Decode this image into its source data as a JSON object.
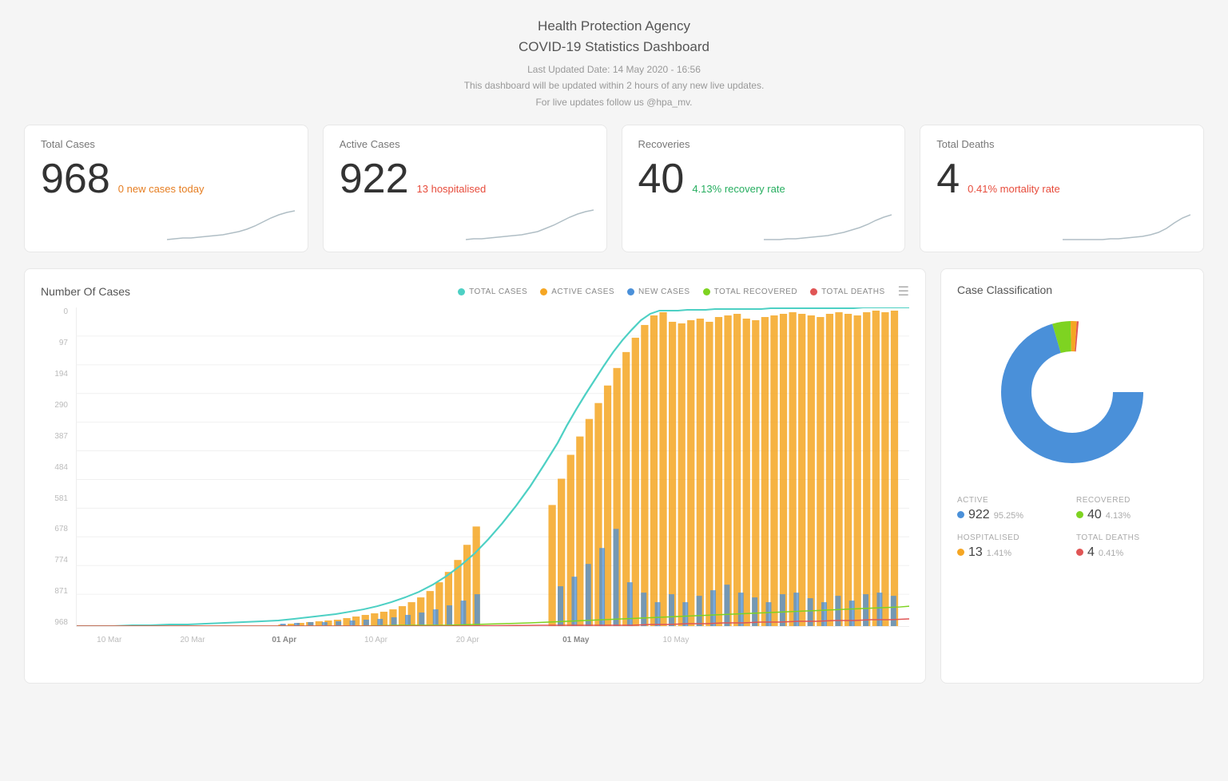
{
  "header": {
    "title_line1": "Health Protection Agency",
    "title_line2": "COVID-19 Statistics Dashboard",
    "updated_label": "Last Updated Date: 14 May 2020 - 16:56",
    "update_note": "This dashboard will be updated within 2 hours of any new live updates.",
    "social": "For live updates follow us @hpa_mv."
  },
  "stat_cards": [
    {
      "label": "Total Cases",
      "number": "968",
      "sub_text": "0 new cases today",
      "sub_color": "orange",
      "id": "total-cases"
    },
    {
      "label": "Active Cases",
      "number": "922",
      "sub_text": "13 hospitalised",
      "sub_color": "red",
      "id": "active-cases"
    },
    {
      "label": "Recoveries",
      "number": "40",
      "sub_text": "4.13% recovery rate",
      "sub_color": "green",
      "id": "recoveries"
    },
    {
      "label": "Total Deaths",
      "number": "4",
      "sub_text": "0.41% mortality rate",
      "sub_color": "red",
      "id": "total-deaths"
    }
  ],
  "main_chart": {
    "title": "Number Of Cases",
    "legend": [
      {
        "label": "TOTAL CASES",
        "color": "#4dd0c4"
      },
      {
        "label": "ACTIVE CASES",
        "color": "#f5a623"
      },
      {
        "label": "NEW CASES",
        "color": "#4a90d9"
      },
      {
        "label": "TOTAL RECOVERED",
        "color": "#7ed321"
      },
      {
        "label": "TOTAL DEATHS",
        "color": "#e05555"
      }
    ],
    "y_labels": [
      "0",
      "97",
      "194",
      "290",
      "387",
      "484",
      "581",
      "678",
      "774",
      "871",
      "968"
    ],
    "x_labels": [
      {
        "label": "10 Mar",
        "pct": 4
      },
      {
        "label": "20 Mar",
        "pct": 13
      },
      {
        "label": "01 Apr",
        "pct": 24
      },
      {
        "label": "10 Apr",
        "pct": 33
      },
      {
        "label": "20 Apr",
        "pct": 44
      },
      {
        "label": "01 May",
        "pct": 57
      },
      {
        "label": "10 May",
        "pct": 70
      }
    ]
  },
  "donut_chart": {
    "title": "Case Classification",
    "segments": [
      {
        "label": "ACTIVE",
        "color": "#4a90d9",
        "value": 922,
        "pct": "95.25%",
        "pct_num": 95.25
      },
      {
        "label": "RECOVERED",
        "color": "#7ed321",
        "value": 40,
        "pct": "4.13%",
        "pct_num": 4.13
      },
      {
        "label": "HOSPITALISED",
        "color": "#f5a623",
        "value": 13,
        "pct": "1.41%",
        "pct_num": 1.41
      },
      {
        "label": "TOTAL DEATHS",
        "color": "#e05555",
        "value": 4,
        "pct": "0.41%",
        "pct_num": 0.41
      }
    ]
  },
  "colors": {
    "total_cases_line": "#4dd0c4",
    "active_cases_bar": "#f5a623",
    "new_cases_bar": "#4a90d9",
    "recovered_line": "#7ed321",
    "deaths_line": "#e05555"
  }
}
